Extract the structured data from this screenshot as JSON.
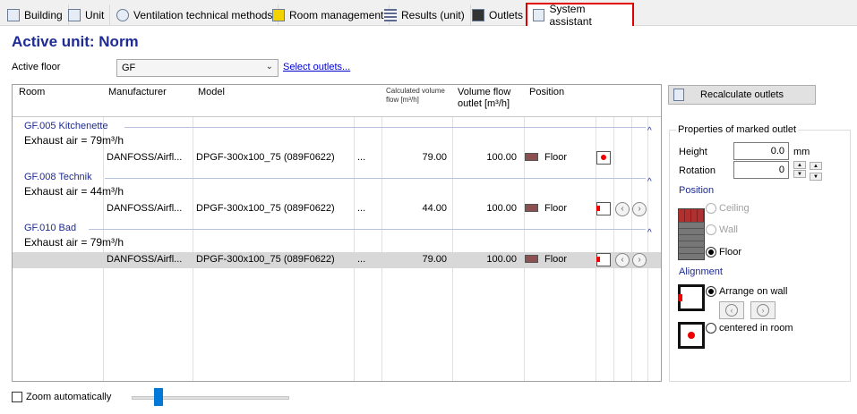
{
  "tabs": [
    {
      "label": "Building"
    },
    {
      "label": "Unit"
    },
    {
      "label": "Ventilation technical methods"
    },
    {
      "label": "Room management"
    },
    {
      "label": "Results (unit)"
    },
    {
      "label": "Outlets"
    },
    {
      "label": "System assistant"
    }
  ],
  "title": "Active unit: Norm",
  "active_floor": {
    "label": "Active floor",
    "value": "GF",
    "link": "Select outlets..."
  },
  "table": {
    "headers": {
      "room": "Room",
      "manufacturer": "Manufacturer",
      "model": "Model",
      "calc_flow": "Calculated volume flow [m³/h]",
      "outlet_flow": "Volume flow outlet [m³/h]",
      "position": "Position"
    },
    "groups": [
      {
        "room": "GF.005   Kitchenette",
        "exhaust": "Exhaust air = 79m³/h",
        "row": {
          "manufacturer": "DANFOSS/Airfl...",
          "model": "DPGF-300x100_75 (089F0622)",
          "more": "...",
          "calc": "79.00",
          "outlet": "100.00",
          "position": "Floor"
        }
      },
      {
        "room": "GF.008   Technik",
        "exhaust": "Exhaust air = 44m³/h",
        "row": {
          "manufacturer": "DANFOSS/Airfl...",
          "model": "DPGF-300x100_75 (089F0622)",
          "more": "...",
          "calc": "44.00",
          "outlet": "100.00",
          "position": "Floor"
        }
      },
      {
        "room": "GF.010   Bad",
        "exhaust": "Exhaust air = 79m³/h",
        "row": {
          "manufacturer": "DANFOSS/Airfl...",
          "model": "DPGF-300x100_75 (089F0622)",
          "more": "...",
          "calc": "79.00",
          "outlet": "100.00",
          "position": "Floor"
        }
      }
    ]
  },
  "zoom_label": "Zoom automatically",
  "zoom_level": 0.15,
  "recalc_label": "Recalculate outlets",
  "props": {
    "title": "Properties of marked outlet",
    "height_label": "Height",
    "height_value": "0.0",
    "height_unit": "mm",
    "rotation_label": "Rotation",
    "rotation_value": "0",
    "position_label": "Position",
    "ceiling": "Ceiling",
    "wall": "Wall",
    "floor": "Floor",
    "alignment_label": "Alignment",
    "arrange": "Arrange on wall",
    "centered": "centered in room"
  },
  "colors": {
    "accent": "#1e2b94",
    "active_tab_border": "#e00000",
    "link": "#0000cc"
  }
}
